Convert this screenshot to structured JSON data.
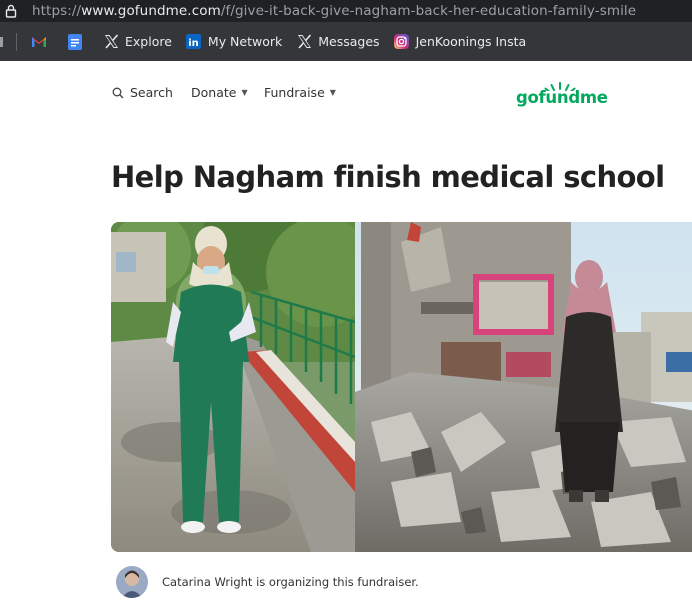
{
  "browser": {
    "url_prefix": "https://",
    "url_domain": "www.gofundme.com",
    "url_path": "/f/give-it-back-give-nagham-back-her-education-family-smile"
  },
  "bookmarks": [
    {
      "label": "",
      "icon": "gmail-icon"
    },
    {
      "label": "",
      "icon": "google-docs-icon"
    },
    {
      "label": "Explore",
      "icon": "x-logo-icon"
    },
    {
      "label": "My Network",
      "icon": "linkedin-icon"
    },
    {
      "label": "Messages",
      "icon": "x-logo-icon"
    },
    {
      "label": "JenKoonings Insta",
      "icon": "instagram-icon"
    }
  ],
  "nav": {
    "search": "Search",
    "donate": "Donate",
    "fundraise": "Fundraise",
    "logo": "gofundme"
  },
  "campaign": {
    "title": "Help Nagham finish medical school",
    "organizer_text": "Catarina Wright is organizing this fundraiser."
  },
  "colors": {
    "brand_green": "#02a95c",
    "chrome_dark": "#202124",
    "bookmarks_bar": "#35363a"
  }
}
